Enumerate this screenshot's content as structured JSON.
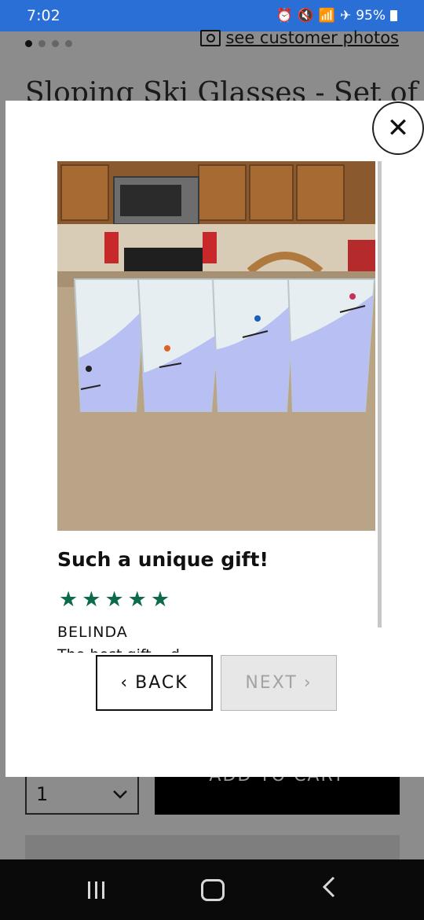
{
  "status_bar": {
    "time": "7:02",
    "battery": "95%",
    "icons": [
      "alarm-icon",
      "mute-icon",
      "wifi-icon",
      "airplane-icon",
      "battery-icon"
    ]
  },
  "background_page": {
    "see_customer_photos": "see customer photos",
    "title": "Sloping Ski Glasses - Set of",
    "quantity_value": "1",
    "add_to_cart_label": "ADD TO CART"
  },
  "modal": {
    "close_label": "✕",
    "review": {
      "title": "Such a unique gift!",
      "rating": 5,
      "reviewer": "BELINDA",
      "body_preview": "The best gift ...d"
    },
    "back_label": "BACK",
    "next_label": "NEXT",
    "back_chevron": "‹",
    "next_chevron": "›"
  },
  "colors": {
    "status_bar": "#2a6fd6",
    "star": "#0d6b4a",
    "overlay": "#8c8c8c"
  }
}
